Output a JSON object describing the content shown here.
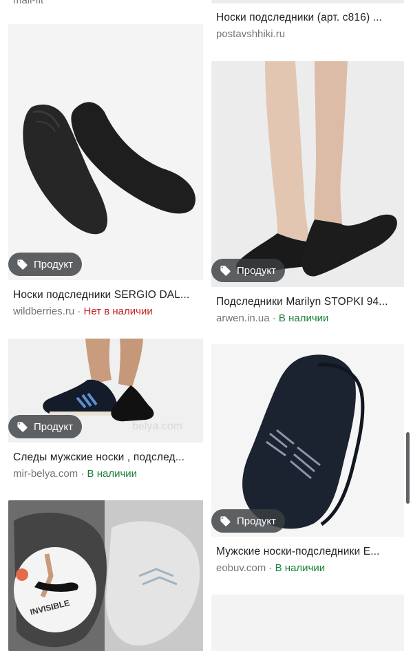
{
  "top_fragment": "mall-fit",
  "badge_label": "Продукт",
  "separator": "·",
  "colors": {
    "in_stock": "#188038",
    "out_of_stock": "#c5221f",
    "badge_bg": "#3c4043"
  },
  "cards": [
    {
      "title": "Носки подследники (арт. c816) ...",
      "source": "postavshhiki.ru"
    },
    {
      "title": "Носки подследники SERGIO DAL...",
      "source": "wildberries.ru",
      "availability": "Нет в наличии"
    },
    {
      "title": "Подследники Marilyn STOPKI 94...",
      "source": "arwen.in.ua",
      "availability": "В наличии"
    },
    {
      "title": "Следы мужские носки , подслед...",
      "source": "mir-belya.com",
      "availability": "В наличии"
    },
    {
      "title": "Мужские носки-подследники E...",
      "source": "eobuv.com",
      "availability": "В наличии"
    }
  ],
  "images": {
    "card4_overlay_text": "INVISIBLE",
    "card3_watermark": "belya.com"
  }
}
